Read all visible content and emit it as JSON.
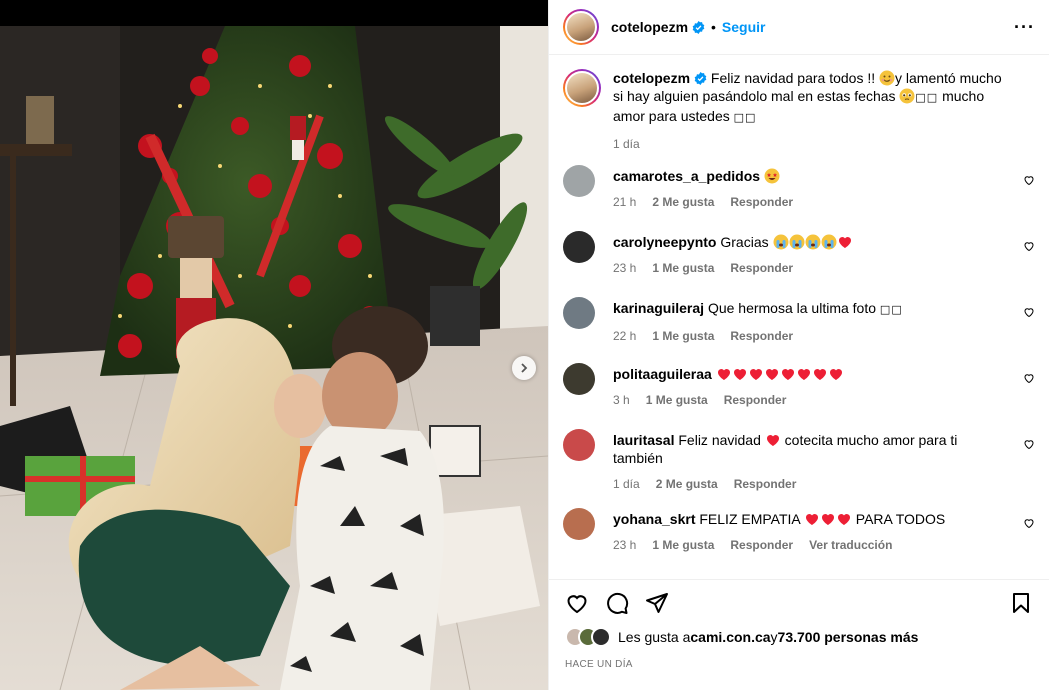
{
  "post": {
    "author": "cotelopezm",
    "follow_label": "Seguir",
    "dot": "•",
    "more_label": "···"
  },
  "caption": {
    "username": "cotelopezm",
    "text_part1": "Feliz navidad para todos !! ",
    "text_part2": "y lamentó mucho si hay alguien pasándolo mal en estas fechas ",
    "text_part3": " mucho amor para ustedes ",
    "squares": "□□",
    "time": "1 día"
  },
  "comments": [
    {
      "username": "camarotes_a_pedidos",
      "text": "",
      "time": "21 h",
      "likes": "2 Me gusta",
      "reply": "Responder",
      "avatar_color": "#9fa4a6"
    },
    {
      "username": "carolyneepynto",
      "text": "Gracias ",
      "time": "23 h",
      "likes": "1 Me gusta",
      "reply": "Responder",
      "avatar_color": "#2a2a2a"
    },
    {
      "username": "karinaguileraj",
      "text": "Que hermosa la ultima foto ",
      "time": "22 h",
      "likes": "1 Me gusta",
      "reply": "Responder",
      "avatar_color": "#6f7a83"
    },
    {
      "username": "politaaguileraa",
      "text": "",
      "time": "3 h",
      "likes": "1 Me gusta",
      "reply": "Responder",
      "avatar_color": "#3d3a2f"
    },
    {
      "username": "lauritasal",
      "text": "Feliz navidad ",
      "text_b": " cotecita mucho amor para ti también",
      "time": "1 día",
      "likes": "2 Me gusta",
      "reply": "Responder",
      "avatar_color": "#c94a4a"
    },
    {
      "username": "yohana_skrt",
      "text": "FELIZ EMPATIA ",
      "text_b": " PARA TODOS",
      "time": "23 h",
      "likes": "1 Me gusta",
      "reply": "Responder",
      "translate": "Ver traducción",
      "avatar_color": "#b86e4f"
    }
  ],
  "likes_line": {
    "prefix": "Les gusta a ",
    "user": "cami.con.ca",
    "mid": " y ",
    "count": "73.700 personas más"
  },
  "timestamp": "HACE UN DÍA",
  "colors": {
    "accent": "#0095f6",
    "heart": "#ed1f35",
    "secondary_text": "#737373"
  },
  "icons": [
    "verified-icon",
    "more-icon",
    "heart-icon",
    "comment-icon",
    "share-icon",
    "bookmark-icon",
    "next-arrow-icon"
  ]
}
